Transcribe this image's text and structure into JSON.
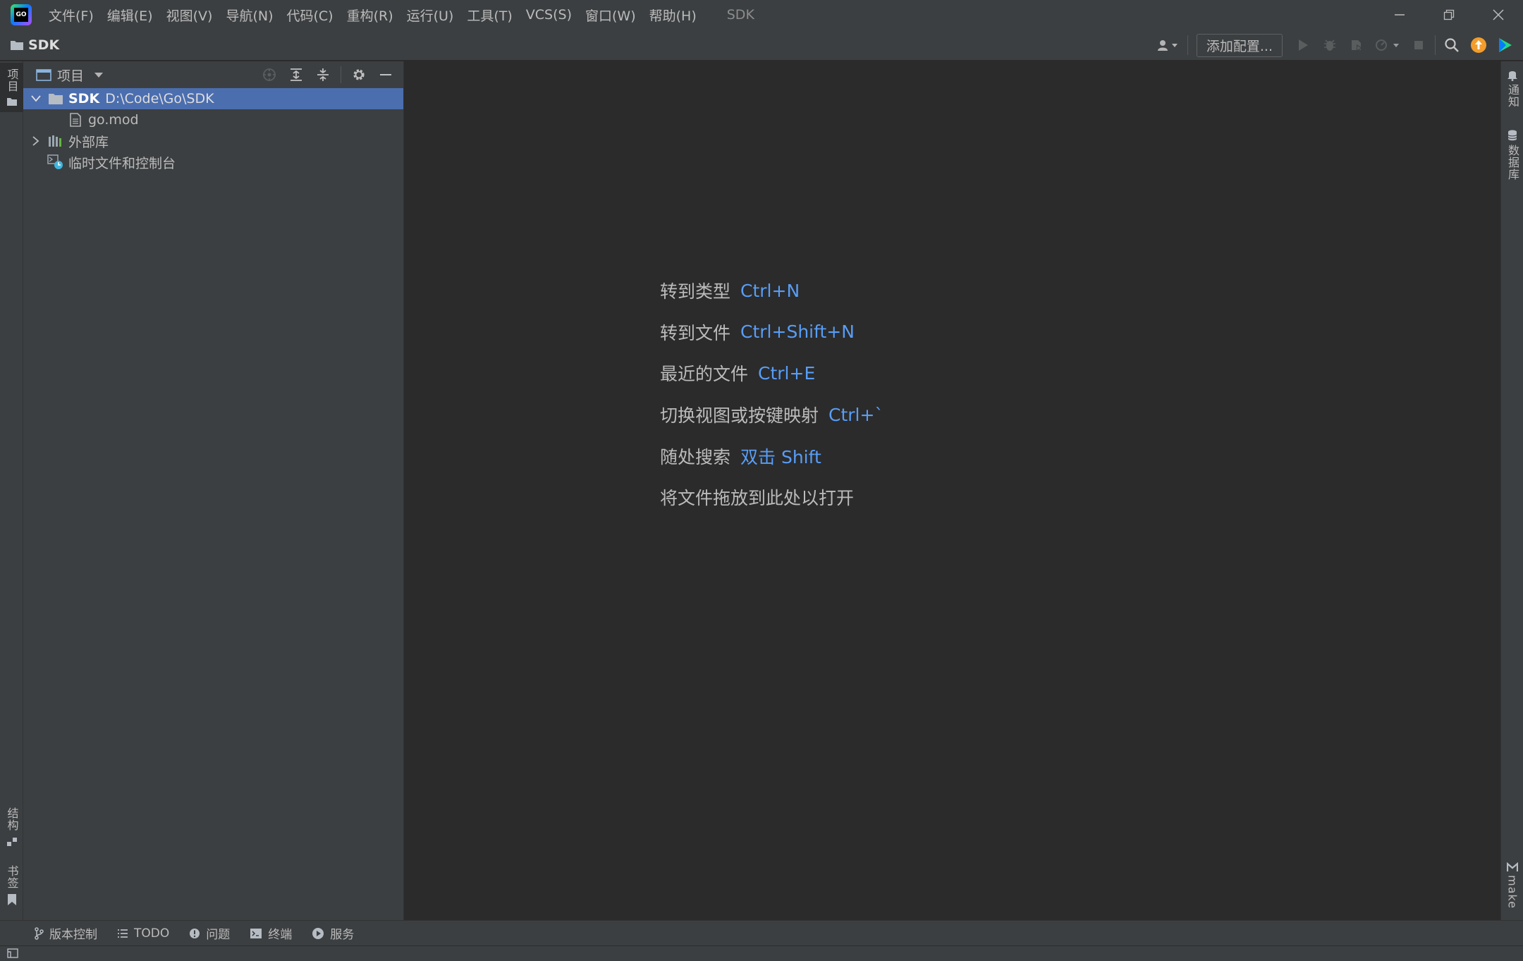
{
  "titlebar": {
    "menu": [
      "文件(F)",
      "编辑(E)",
      "视图(V)",
      "导航(N)",
      "代码(C)",
      "重构(R)",
      "运行(U)",
      "工具(T)",
      "VCS(S)",
      "窗口(W)",
      "帮助(H)"
    ],
    "window_title": "SDK"
  },
  "navbar": {
    "project_name": "SDK",
    "add_config_label": "添加配置..."
  },
  "project_panel": {
    "title": "项目",
    "root": {
      "name": "SDK",
      "path": "D:\\Code\\Go\\SDK"
    },
    "file": "go.mod",
    "external_libs": "外部库",
    "scratches": "临时文件和控制台"
  },
  "left_strip": {
    "project_tab": "项目",
    "structure_tab": "结构",
    "bookmarks_tab": "书签"
  },
  "right_strip": {
    "notifications_tab": "通知",
    "database_tab": "数据库",
    "make_tab": "make"
  },
  "editor_hints": [
    {
      "label": "转到类型",
      "key": "Ctrl+N"
    },
    {
      "label": "转到文件",
      "key": "Ctrl+Shift+N"
    },
    {
      "label": "最近的文件",
      "key": "Ctrl+E"
    },
    {
      "label": "切换视图或按键映射",
      "key": "Ctrl+`"
    },
    {
      "label": "随处搜索",
      "key": "双击 Shift"
    },
    {
      "label": "将文件拖放到此处以打开",
      "key": ""
    }
  ],
  "bottom_tabs": [
    "版本控制",
    "TODO",
    "问题",
    "终端",
    "服务"
  ],
  "colors": {
    "background": "#2b2b2b",
    "panel": "#3c3f41",
    "selection": "#4b6eaf",
    "shortcut": "#589df6"
  }
}
